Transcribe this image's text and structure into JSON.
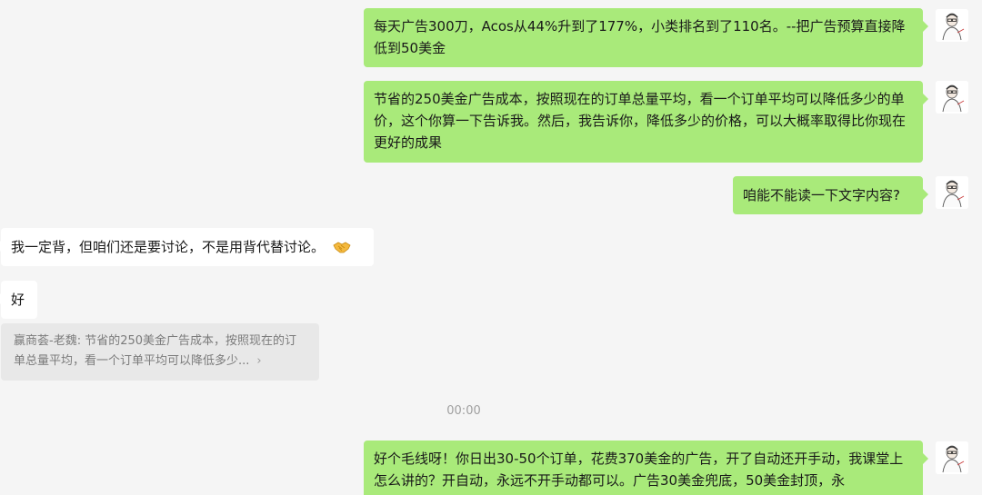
{
  "messages": [
    {
      "side": "out",
      "text": "每天广告300刀，Acos从44%升到了177%，小类排名到了110名。--把广告预算直接降低到50美金"
    },
    {
      "side": "out",
      "text": "节省的250美金广告成本，按照现在的订单总量平均，看一个订单平均可以降低多少的单价，这个你算一下告诉我。然后，我告诉你，降低多少的价格，可以大概率取得比你现在更好的成果"
    },
    {
      "side": "out",
      "text": "咱能不能读一下文字内容?"
    },
    {
      "side": "in",
      "text": "我一定背，但咱们还是要讨论，不是用背代替讨论。",
      "emoji": "handshake-emoji"
    },
    {
      "side": "in",
      "text": "好"
    },
    {
      "side": "out",
      "text": "好个毛线呀！你日出30-50个订单，花费370美金的广告，开了自动还开手动，我课堂上怎么讲的？开自动，永远不开手动都可以。广告30美金兜底，50美金封顶，永"
    }
  ],
  "quote": {
    "text": "赢商荟-老魏: 节省的250美金广告成本，按照现在的订单总量平均，看一个订单平均可以降低多少...",
    "arrow": "›"
  },
  "timestamp": "00:00",
  "colors": {
    "outgoing_bubble": "#a9ea7a",
    "incoming_bubble": "#ffffff",
    "background": "#f5f5f5"
  }
}
